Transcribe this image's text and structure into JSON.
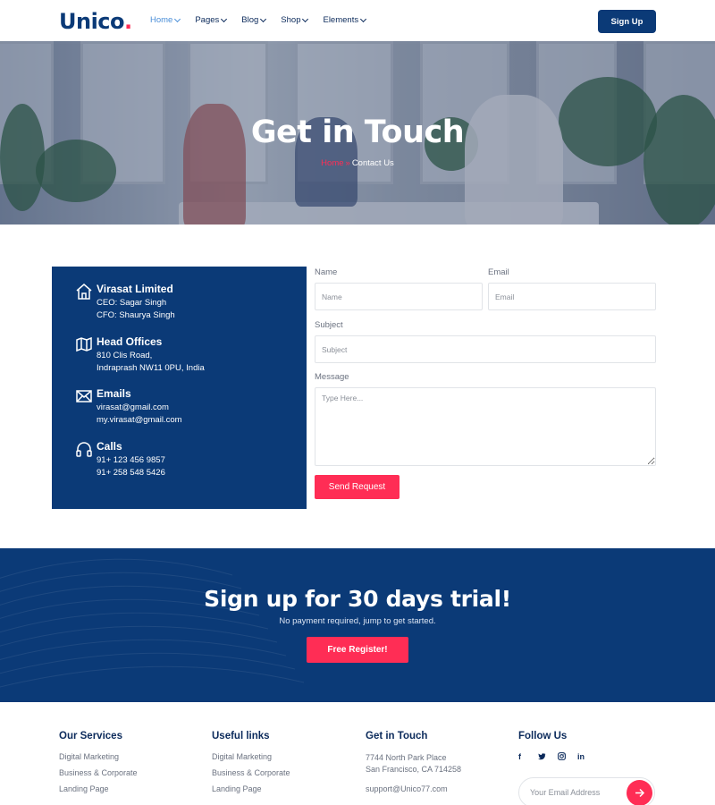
{
  "brand": {
    "name": "Unico",
    "dot": ".",
    "accent": "#ff2d55",
    "primary": "#0b3a77"
  },
  "nav": {
    "items": [
      {
        "label": "Home",
        "active": true
      },
      {
        "label": "Pages"
      },
      {
        "label": "Blog"
      },
      {
        "label": "Shop"
      },
      {
        "label": "Elements"
      }
    ],
    "signup_label": "Sign Up"
  },
  "hero": {
    "title": "Get in Touch",
    "breadcrumb_home": "Home",
    "breadcrumb_sep": "»",
    "breadcrumb_current": "Contact Us"
  },
  "contact_info": [
    {
      "icon": "home-icon",
      "title": "Virasat Limited",
      "lines": [
        "CEO: Sagar Singh",
        "CFO: Shaurya Singh"
      ]
    },
    {
      "icon": "map-icon",
      "title": "Head Offices",
      "lines": [
        "810 Clis Road,",
        "Indraprash NW11 0PU, India"
      ]
    },
    {
      "icon": "mail-icon",
      "title": "Emails",
      "lines": [
        "virasat@gmail.com",
        "my.virasat@gmail.com"
      ]
    },
    {
      "icon": "headphones-icon",
      "title": "Calls",
      "lines": [
        "91+ 123 456 9857",
        "91+ 258 548 5426"
      ]
    }
  ],
  "form": {
    "name_label": "Name",
    "name_placeholder": "Name",
    "email_label": "Email",
    "email_placeholder": "Email",
    "subject_label": "Subject",
    "subject_placeholder": "Subject",
    "message_label": "Message",
    "message_placeholder": "Type Here...",
    "submit_label": "Send Request"
  },
  "cta": {
    "title": "Sign up for 30 days trial!",
    "subtitle": "No payment required, jump to get started.",
    "button_label": "Free Register!"
  },
  "footer": {
    "services": {
      "title": "Our Services",
      "links": [
        "Digital Marketing",
        "Business & Corporate",
        "Landing Page"
      ]
    },
    "useful": {
      "title": "Useful links",
      "links": [
        "Digital Marketing",
        "Business & Corporate",
        "Landing Page"
      ]
    },
    "contact": {
      "title": "Get in Touch",
      "address_1": "7744 North Park Place",
      "address_2": "San Francisco, CA 714258",
      "email": "support@Unico77.com"
    },
    "follow": {
      "title": "Follow Us",
      "socials": [
        "f",
        "t",
        "ig",
        "in"
      ],
      "email_placeholder": "Your Email Address"
    }
  }
}
